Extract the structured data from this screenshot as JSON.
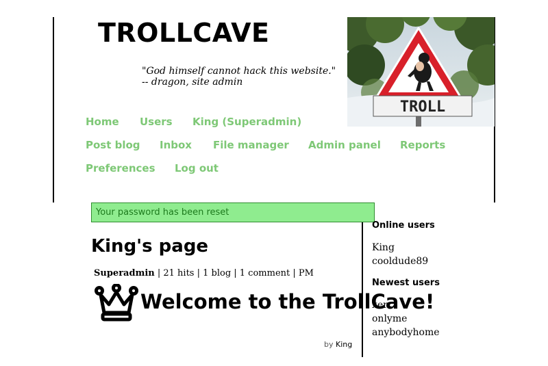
{
  "header": {
    "title": "TROLLCAVE",
    "quote": "\"God himself cannot hack this website.\" -- dragon, site admin",
    "image_sign_text": "TROLL"
  },
  "nav": [
    {
      "label": "Home"
    },
    {
      "label": "Users"
    },
    {
      "label": "King (Superadmin)"
    },
    {
      "label": "Post blog"
    },
    {
      "label": "Inbox"
    },
    {
      "label": "File manager"
    },
    {
      "label": "Admin panel"
    },
    {
      "label": "Reports"
    },
    {
      "label": "Preferences"
    },
    {
      "label": "Log out"
    }
  ],
  "flash": {
    "message": "Your password has been reset"
  },
  "profile": {
    "heading": "King's page",
    "role": "Superadmin",
    "stats": " | 21 hits | 1 blog | 1 comment | PM"
  },
  "post": {
    "icon": "crown-icon",
    "title": "Welcome to the TrollCave!",
    "by_label": "by",
    "author": "King"
  },
  "sidebar": {
    "online_heading": "Online users",
    "online_users": [
      "King",
      "cooldude89"
    ],
    "newest_heading": "Newest users",
    "newest_users": [
      "xer",
      "onlyme",
      "anybodyhome"
    ]
  },
  "colors": {
    "nav_link": "#7ec876",
    "flash_bg": "#8fec8f",
    "flash_border": "#2e8b2e",
    "flash_text": "#1d7a1d"
  }
}
